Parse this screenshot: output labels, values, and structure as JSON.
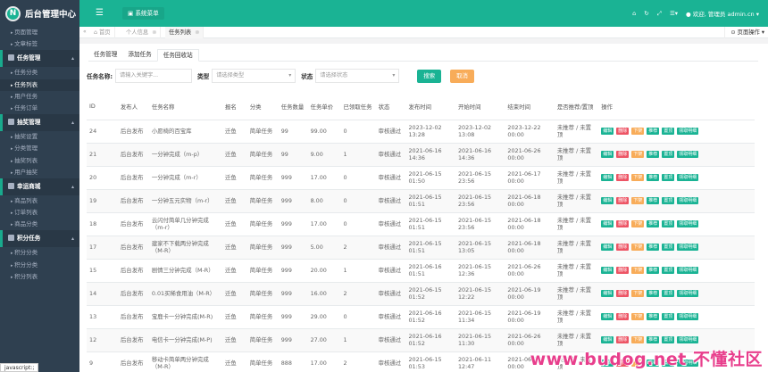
{
  "app": {
    "title": "后台管理中心",
    "logo_letter": "N"
  },
  "sidebar": {
    "groups": [
      {
        "head": "",
        "items": [
          "页面管理",
          "文章标签"
        ]
      },
      {
        "head": "任务管理",
        "items": [
          "任务分类",
          "任务列表",
          "用户任务",
          "任务订单"
        ]
      },
      {
        "head": "抽奖管理",
        "items": [
          "抽奖设置",
          "分类管理",
          "抽奖列表",
          "用户抽奖"
        ]
      },
      {
        "head": "幸运商城",
        "items": [
          "商品列表",
          "订单列表",
          "商品分类"
        ]
      },
      {
        "head": "积分任务",
        "items": [
          "积分分类",
          "积分分类",
          "积分列表"
        ]
      }
    ],
    "active_item": "任务列表"
  },
  "topbar": {
    "menu_label": "系统菜单",
    "welcome": "欢迎, 管理员",
    "user": "admin.cn"
  },
  "tabs": {
    "home": "首页",
    "items": [
      "个人信息",
      "任务列表"
    ],
    "page_ops": "页面操作"
  },
  "subtabs": [
    "任务管理",
    "添加任务",
    "任务回收站"
  ],
  "search": {
    "name_label": "任务名称:",
    "name_placeholder": "请输入关键字...",
    "type_label": "类型",
    "type_placeholder": "请选择类型",
    "status_label": "状态",
    "status_placeholder": "请选择状态",
    "search_btn": "搜索",
    "cancel_btn": "取消"
  },
  "table": {
    "headers": [
      "ID",
      "发布人",
      "任务名称",
      "报名",
      "分类",
      "任务数量",
      "任务单价",
      "已领取任务",
      "状态",
      "发布时间",
      "开始时间",
      "结束时间",
      "是否推荐/置顶",
      "操作"
    ],
    "rows": [
      [
        "24",
        "后台发布",
        "小愿椅的百宝库",
        "迁鱼",
        "简单任务",
        "99",
        "99.00",
        "0",
        "审核通过",
        "2023-12-02 13:28",
        "2023-12-02 13:08",
        "2023-12-22 00:00",
        "未推荐 / 未置顶"
      ],
      [
        "21",
        "后台发布",
        "一分钟完成（m-p）",
        "迁鱼",
        "简单任务",
        "99",
        "9.00",
        "1",
        "审核通过",
        "2021-06-16 14:36",
        "2021-06-16 14:36",
        "2021-06-26 00:00",
        "未推荐 / 未置顶"
      ],
      [
        "20",
        "后台发布",
        "一分钟完成（m-r）",
        "迁鱼",
        "简单任务",
        "999",
        "17.00",
        "0",
        "审核通过",
        "2021-06-15 01:50",
        "2021-06-15 23:56",
        "2021-06-17 00:00",
        "未推荐 / 未置顶"
      ],
      [
        "19",
        "后台发布",
        "一分钟五元实物（m-r）",
        "迁鱼",
        "简单任务",
        "999",
        "8.00",
        "0",
        "审核通过",
        "2021-06-15 01:51",
        "2021-06-15 23:56",
        "2021-06-18 00:00",
        "未推荐 / 未置顶"
      ],
      [
        "18",
        "后台发布",
        "云闪付简单几分钟完成（m-r）",
        "迁鱼",
        "简单任务",
        "999",
        "17.00",
        "0",
        "审核通过",
        "2021-06-15 01:51",
        "2021-06-15 23:56",
        "2021-06-18 00:00",
        "未推荐 / 未置顶"
      ],
      [
        "17",
        "后台发布",
        "建家不下载两分钟完成（M-R）",
        "迁鱼",
        "简单任务",
        "999",
        "5.00",
        "2",
        "审核通过",
        "2021-06-15 01:51",
        "2021-06-15 13:05",
        "2021-06-18 00:00",
        "未推荐 / 未置顶"
      ],
      [
        "15",
        "后台发布",
        "剧情三分钟完成（M-R）",
        "迁鱼",
        "简单任务",
        "999",
        "20.00",
        "1",
        "审核通过",
        "2021-06-16 01:51",
        "2021-06-15 12:36",
        "2021-06-26 00:00",
        "未推荐 / 未置顶"
      ],
      [
        "14",
        "后台发布",
        "0.01买稀食用油（M-R）",
        "迁鱼",
        "简单任务",
        "999",
        "16.00",
        "2",
        "审核通过",
        "2021-06-15 01:52",
        "2021-06-15 12:22",
        "2021-06-19 00:00",
        "未推荐 / 未置顶"
      ],
      [
        "13",
        "后台发布",
        "宝鹿卡一分钟完成(M-R)",
        "迁鱼",
        "简单任务",
        "999",
        "29.00",
        "0",
        "审核通过",
        "2021-06-16 01:52",
        "2021-06-15 11:34",
        "2021-06-19 00:00",
        "未推荐 / 未置顶"
      ],
      [
        "12",
        "后台发布",
        "电信卡一分钟完成(M-P)",
        "迁鱼",
        "简单任务",
        "999",
        "27.00",
        "1",
        "审核通过",
        "2021-06-16 01:52",
        "2021-06-15 11:30",
        "2021-06-26 00:00",
        "未推荐 / 未置顶"
      ],
      [
        "9",
        "后台发布",
        "移动卡简单两分钟完成（M-R）",
        "迁鱼",
        "简单任务",
        "888",
        "17.00",
        "2",
        "审核通过",
        "2021-06-15 01:53",
        "2021-06-11 12:47",
        "2021-06-16 00:00",
        "未推荐 / 未置顶"
      ]
    ],
    "row_actions": [
      "编辑",
      "删除",
      "下架",
      "推荐",
      "置顶",
      "领取明细"
    ]
  },
  "watermark": "www.budog.net 不懂社区",
  "statusbar": "javascript:;"
}
